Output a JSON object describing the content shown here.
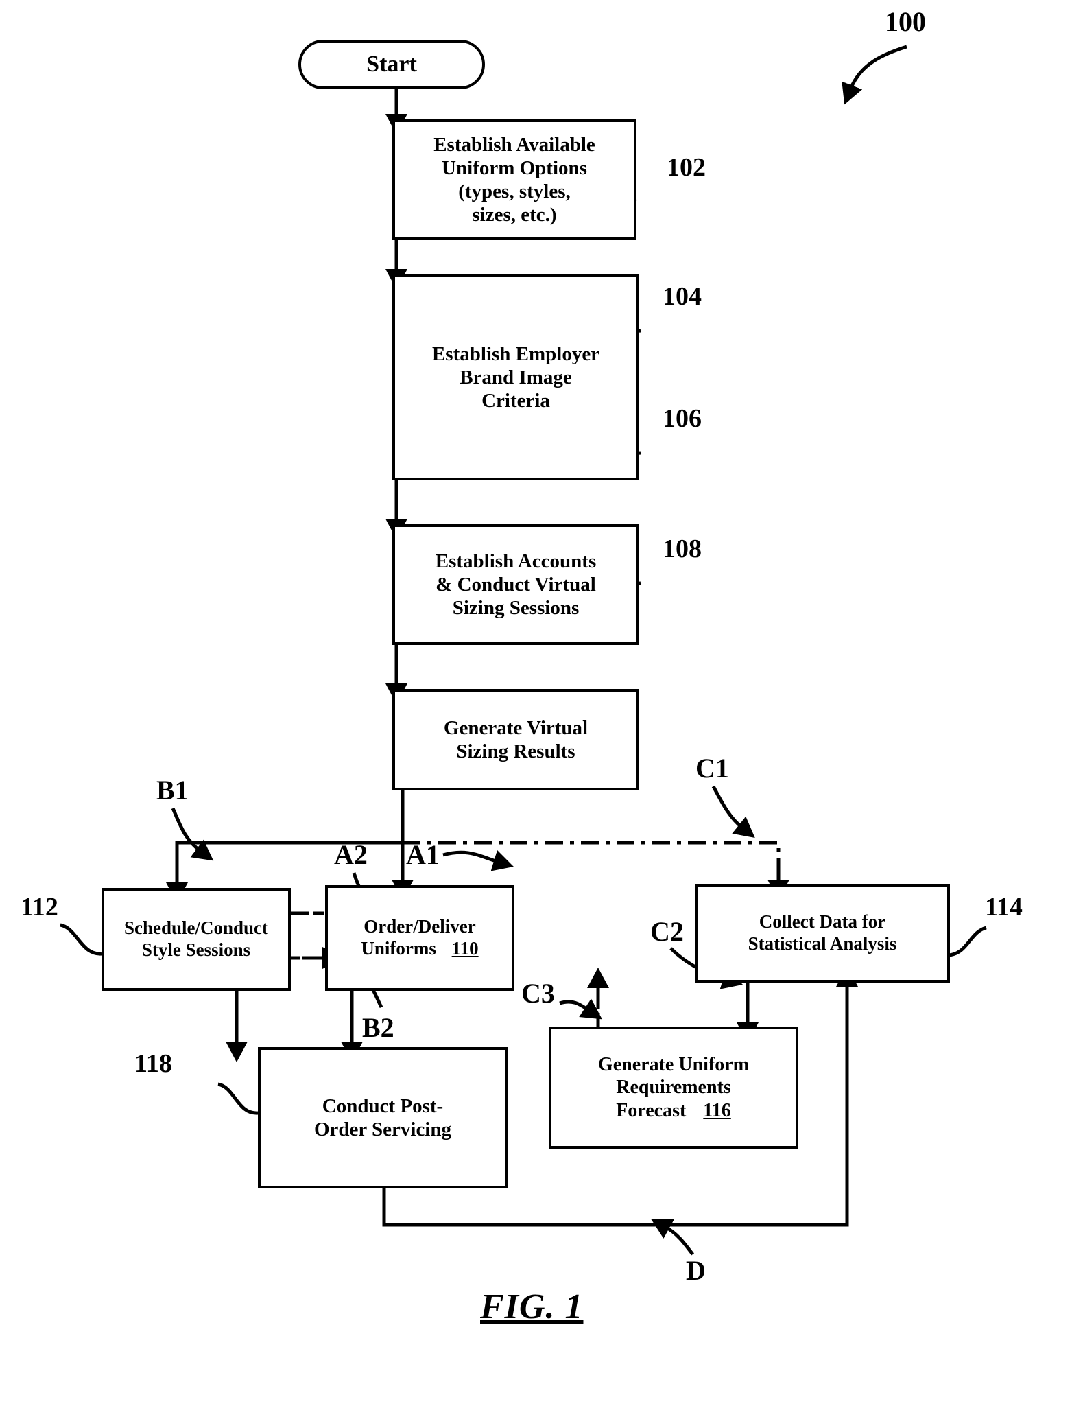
{
  "figure": {
    "caption": "FIG. 1",
    "system_ref": "100"
  },
  "nodes": [
    {
      "id": "start",
      "ref": "",
      "lines": [
        "Start"
      ]
    },
    {
      "id": "n102",
      "ref": "102",
      "lines": [
        "Establish Available",
        "Uniform Options",
        "(types, styles,",
        "sizes, etc.)"
      ]
    },
    {
      "id": "n104",
      "ref": "104",
      "lines": [
        "Establish Employer",
        "Brand Image",
        "Criteria"
      ]
    },
    {
      "id": "n106",
      "ref": "106",
      "lines": [
        "Establish Accounts",
        "& Conduct Virtual",
        "Sizing Sessions"
      ]
    },
    {
      "id": "n108",
      "ref": "108",
      "lines": [
        "Generate Virtual",
        "Sizing Results"
      ]
    },
    {
      "id": "n112",
      "ref": "112",
      "lines": [
        "Schedule/Conduct",
        "Style Sessions"
      ]
    },
    {
      "id": "n110",
      "ref": "110",
      "lines": [
        "Order/Deliver",
        "Uniforms"
      ],
      "inline_ref": "110"
    },
    {
      "id": "n114",
      "ref": "114",
      "lines": [
        "Collect Data for",
        "Statistical Analysis"
      ]
    },
    {
      "id": "n118",
      "ref": "118",
      "lines": [
        "Conduct Post-",
        "Order Servicing"
      ]
    },
    {
      "id": "n116",
      "ref": "116",
      "lines": [
        "Generate Uniform",
        "Requirements",
        "Forecast"
      ],
      "inline_ref": "116"
    }
  ],
  "connector_labels": [
    {
      "id": "b1",
      "text": "B1"
    },
    {
      "id": "a2",
      "text": "A2"
    },
    {
      "id": "a1",
      "text": "A1"
    },
    {
      "id": "c1",
      "text": "C1"
    },
    {
      "id": "c2",
      "text": "C2"
    },
    {
      "id": "c3",
      "text": "C3"
    },
    {
      "id": "b2",
      "text": "B2"
    },
    {
      "id": "d",
      "text": "D"
    }
  ],
  "ref_labels": {
    "r100": "100",
    "r102": "102",
    "r104": "104",
    "r106": "106",
    "r108": "108",
    "r110": "110",
    "r112": "112",
    "r114": "114",
    "r116": "116",
    "r118": "118"
  },
  "colors": {
    "ink": "#000000",
    "paper": "#ffffff"
  }
}
